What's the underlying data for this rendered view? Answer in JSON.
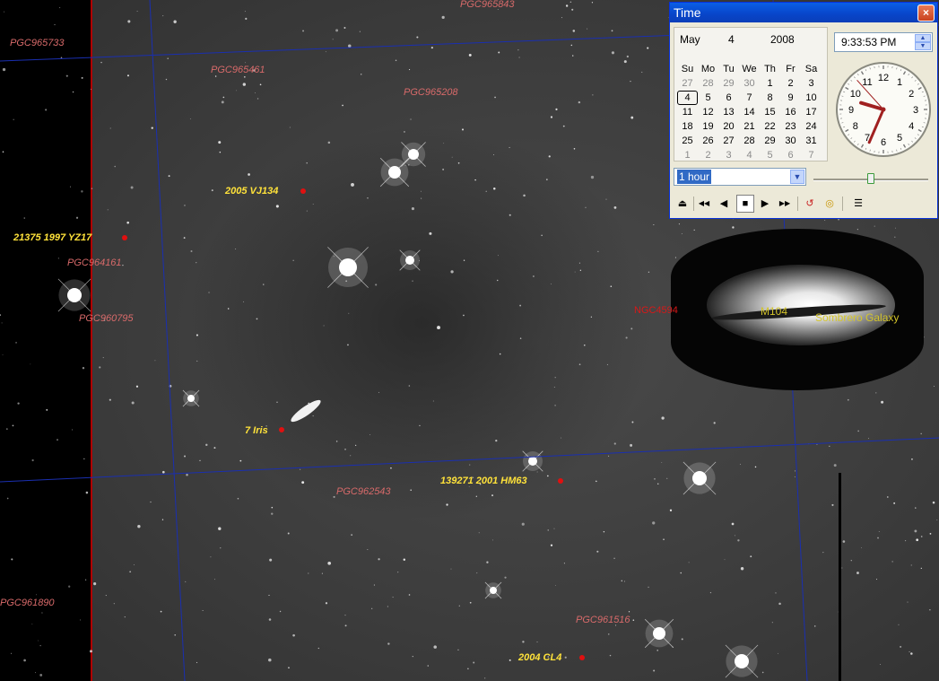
{
  "sky_labels": {
    "pgc_top": "PGC965843",
    "pgc_left_top": "PGC965733",
    "pgc_461": "PGC965461",
    "pgc_208": "PGC965208",
    "pgc_161": "PGC964161",
    "pgc_795": "PGC960795",
    "pgc_543": "PGC962543",
    "pgc_890": "PGC961890",
    "pgc_516": "PGC961516",
    "ast_vj134": "2005 VJ134",
    "ast_yz17": "21375 1997 YZ17",
    "ast_iris": "7 Iris",
    "ast_hm63": "139271 2001 HM63",
    "ast_cl4": "2004 CL4",
    "ngc": "NGC4594",
    "m104": "M104",
    "sombrero": "Sombrero Galaxy"
  },
  "time_window": {
    "title": "Time",
    "close_glyph": "×",
    "calendar": {
      "month": "May",
      "day": "4",
      "year": "2008",
      "weekdays": [
        "Su",
        "Mo",
        "Tu",
        "We",
        "Th",
        "Fr",
        "Sa"
      ],
      "rows": [
        [
          "27",
          "28",
          "29",
          "30",
          "1",
          "2",
          "3"
        ],
        [
          "4",
          "5",
          "6",
          "7",
          "8",
          "9",
          "10"
        ],
        [
          "11",
          "12",
          "13",
          "14",
          "15",
          "16",
          "17"
        ],
        [
          "18",
          "19",
          "20",
          "21",
          "22",
          "23",
          "24"
        ],
        [
          "25",
          "26",
          "27",
          "28",
          "29",
          "30",
          "31"
        ],
        [
          "1",
          "2",
          "3",
          "4",
          "5",
          "6",
          "7"
        ]
      ],
      "selected": "4"
    },
    "time_value": "9:33:53 PM",
    "clock": {
      "numerals": [
        "12",
        "1",
        "2",
        "3",
        "4",
        "5",
        "6",
        "7",
        "8",
        "9",
        "10",
        "11"
      ],
      "hour": 9,
      "minute": 33,
      "second": 53
    },
    "step_select": {
      "value": "1 hour"
    },
    "speed_slider": {
      "value_fraction": 0.5
    },
    "toolbar": {
      "eject": "⏏",
      "fast_back": "◀◀",
      "back": "◀",
      "stop": "■",
      "fwd": "▶",
      "fast_fwd": "▶▶",
      "sync": "↺",
      "now": "◎",
      "options": "☰"
    }
  }
}
